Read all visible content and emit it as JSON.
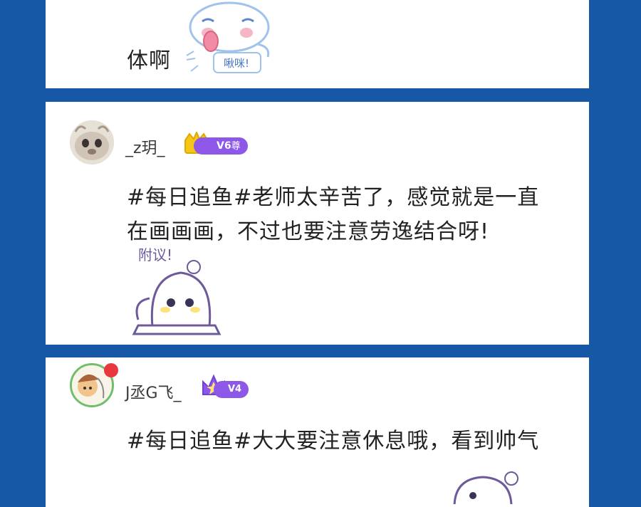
{
  "comments": [
    {
      "text": "体啊",
      "sticker_text": "啾咪!"
    },
    {
      "username": "_z玥_",
      "vip_level": "V6",
      "vip_suffix": "尊",
      "text_line1": "#每日追鱼#老师太辛苦了，感觉就是一直",
      "text_line2": "在画画画，不过也要注意劳逸结合呀!",
      "sticker_text": "附议!"
    },
    {
      "username": "J丞G飞_",
      "vip_level": "V4",
      "text_line1": "#每日追鱼#大大要注意休息哦，看到帅气"
    }
  ],
  "colors": {
    "background": "#1658a6",
    "card": "#ffffff",
    "vip_badge": "#8d57e8",
    "crown_gold": "#f5c518"
  }
}
